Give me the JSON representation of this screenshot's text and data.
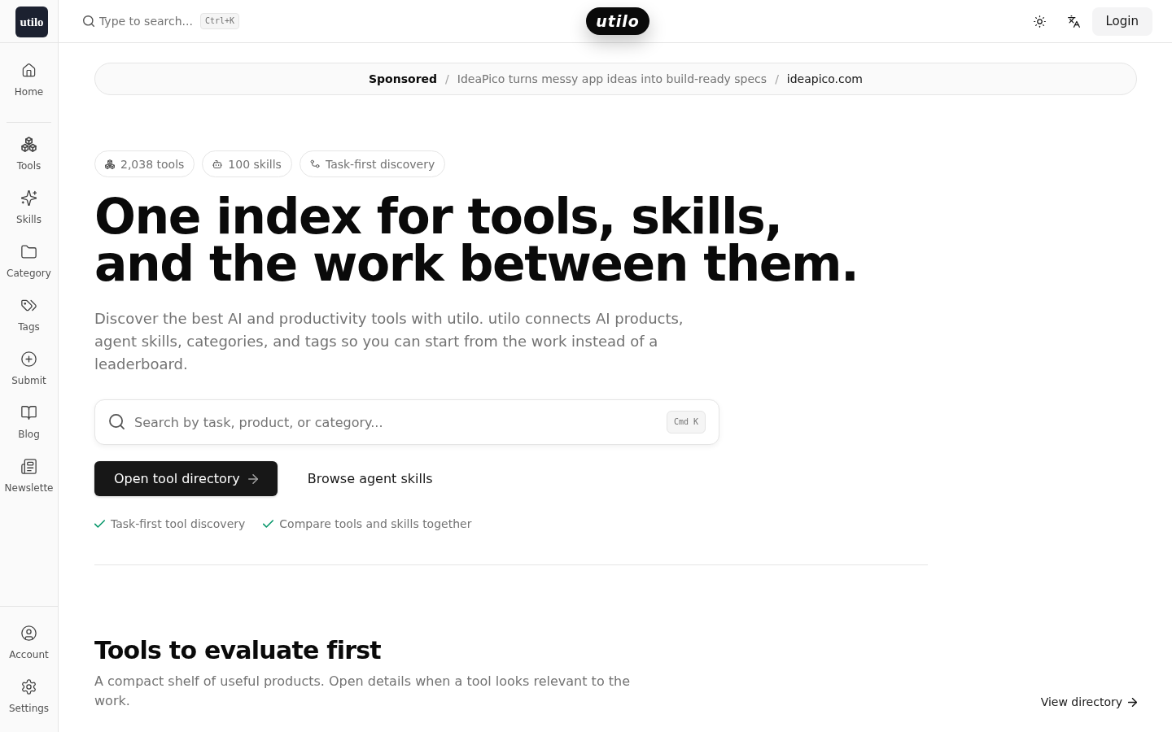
{
  "sidebar": {
    "logo": "utilo",
    "top_items": [
      {
        "label": "Home"
      }
    ],
    "items": [
      {
        "label": "Tools"
      },
      {
        "label": "Skills"
      },
      {
        "label": "Category"
      },
      {
        "label": "Tags"
      },
      {
        "label": "Submit"
      },
      {
        "label": "Blog"
      },
      {
        "label": "Newslette"
      }
    ],
    "bottom_items": [
      {
        "label": "Account"
      },
      {
        "label": "Settings"
      }
    ]
  },
  "topbar": {
    "search": {
      "placeholder": "Type to search...",
      "shortcut": "Ctrl+K"
    },
    "brand": "utilo",
    "login": "Login"
  },
  "sponsor": [
    {
      "kind": "label",
      "text": "Sponsored"
    },
    {
      "kind": "separator",
      "text": "/"
    },
    {
      "kind": "text",
      "text": "IdeaPico turns messy app ideas into build-ready specs"
    },
    {
      "kind": "separator",
      "text": "/"
    },
    {
      "kind": "link",
      "text": "ideapico.com"
    }
  ],
  "hero": {
    "chips": [
      {
        "text": "2,038 tools"
      },
      {
        "text": "100 skills"
      },
      {
        "text": "Task-first discovery"
      }
    ],
    "title": "One index for tools, skills,\nand the work between them.",
    "description": "Discover the best AI and productivity tools with utilo. utilo connects AI products, agent skills, categories, and tags so you can start from the work instead of a leaderboard.",
    "search": {
      "placeholder": "Search by task, product, or category...",
      "shortcut": "Cmd K"
    },
    "actions": [
      {
        "kind": "primary",
        "label": "Open tool directory"
      },
      {
        "kind": "secondary",
        "label": "Browse agent skills"
      }
    ],
    "highlights": [
      {
        "text": "Task-first tool discovery"
      },
      {
        "text": "Compare tools and skills together"
      }
    ]
  },
  "section": {
    "title": "Tools to evaluate first",
    "description": "A compact shelf of useful products. Open details when a tool looks relevant to the work.",
    "link": "View directory"
  }
}
